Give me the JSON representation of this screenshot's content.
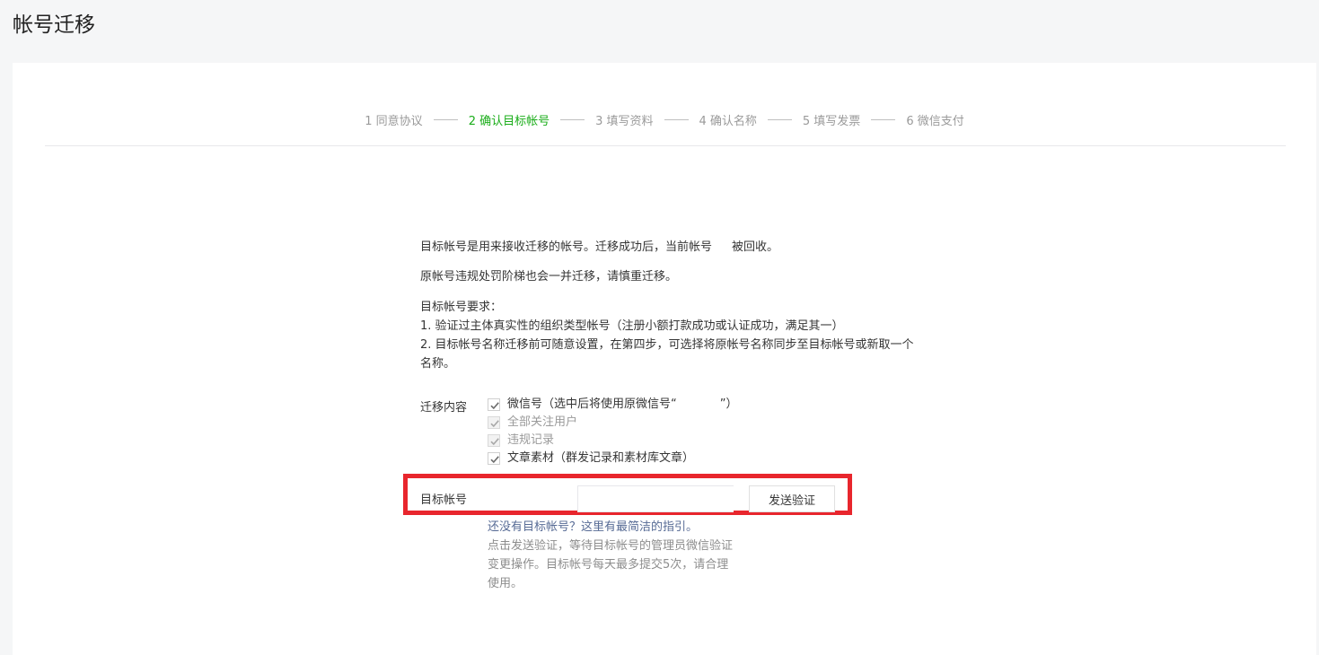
{
  "header": {
    "title": "帐号迁移"
  },
  "steps": [
    {
      "label": "1 同意协议",
      "active": false
    },
    {
      "label": "2 确认目标帐号",
      "active": true
    },
    {
      "label": "3 填写资料",
      "active": false
    },
    {
      "label": "4 确认名称",
      "active": false
    },
    {
      "label": "5 填写发票",
      "active": false
    },
    {
      "label": "6 微信支付",
      "active": false
    }
  ],
  "intro": {
    "p1_before": "目标帐号是用来接收迁移的帐号。迁移成功后，当前帐号",
    "p1_after": "被回收。",
    "p2": "原帐号违规处罚阶梯也会一并迁移，请慎重迁移。",
    "req_title": "目标帐号要求：",
    "req_1": "1. 验证过主体真实性的组织类型帐号（注册小额打款成功或认证成功，满足其一）",
    "req_2": "2. 目标帐号名称迁移前可随意设置，在第四步，可选择将原帐号名称同步至目标帐号或新取一个名称。"
  },
  "migration": {
    "label": "迁移内容",
    "items": [
      {
        "before": "微信号（选中后将使用原微信号“",
        "after": "”）",
        "checked": true,
        "disabled": false
      },
      {
        "before": "全部关注用户",
        "after": "",
        "checked": true,
        "disabled": true
      },
      {
        "before": "违规记录",
        "after": "",
        "checked": true,
        "disabled": true
      },
      {
        "before": "文章素材（群发记录和素材库文章）",
        "after": "",
        "checked": true,
        "disabled": false
      }
    ]
  },
  "target": {
    "label": "目标帐号",
    "input_value": "",
    "input_placeholder": "",
    "send_label": "发送验证"
  },
  "guide": {
    "question": "还没有目标帐号？",
    "link": "这里有最简洁的指引。"
  },
  "tips": "点击发送验证，等待目标帐号的管理员微信验证变更操作。目标帐号每天最多提交5次，请合理使用。",
  "colors": {
    "active_step": "#1aad19",
    "highlight": "#e8262d",
    "link": "#576b95"
  }
}
